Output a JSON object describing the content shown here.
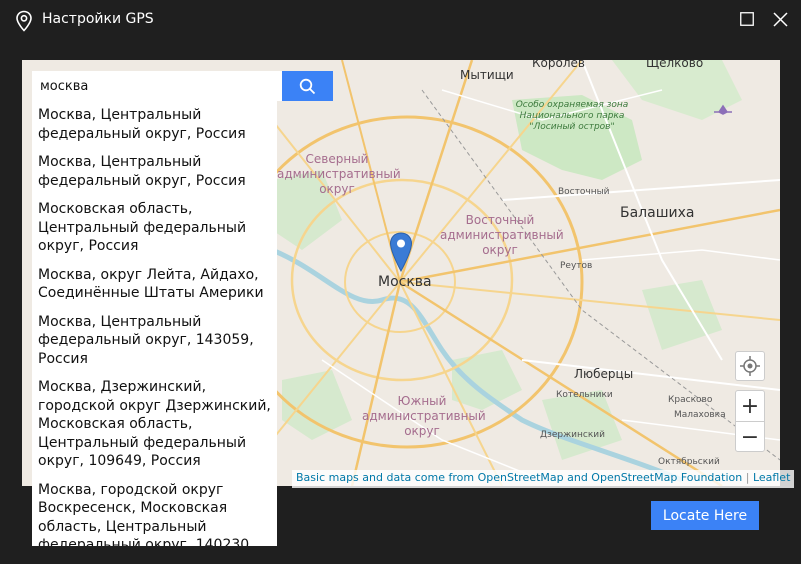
{
  "window": {
    "title": "Настройки GPS"
  },
  "search": {
    "value": "москва"
  },
  "results": [
    "Москва, Центральный федеральный округ, Россия",
    "Москва, Центральный федеральный округ, Россия",
    "Московская область, Центральный федеральный округ, Россия",
    "Москва, округ Лейта, Айдахо, Соединённые Штаты Америки",
    "Москва, Центральный федеральный округ, 143059, Россия",
    "Москва, Дзержинский, городской округ Дзержинский, Московская область, Центральный федеральный округ, 109649, Россия",
    "Москва, городской округ Воскресенск, Московская область, Центральный федеральный округ, 140230"
  ],
  "map": {
    "labels": {
      "mytishchi": "Мытищи",
      "korolev": "Королев",
      "shchelkovo": "Щелково",
      "park": "Особо охраняемая зона Национального парка \"Лосиный остров\"",
      "north": "Северный административный округ",
      "vostochny": "Восточный",
      "east": "Восточный административный округ",
      "balashikha": "Балашиха",
      "moscow": "Москва",
      "reutov": "Реутов",
      "lyubertsy": "Люберцы",
      "kotelniki": "Котельники",
      "krasnovo": "Красково",
      "malakhovka": "Малаховка",
      "south": "Южный административный округ",
      "dzerzhinsky": "Дзержинский",
      "oktyabrsky": "Октябрьский"
    },
    "zoom_in": "+",
    "zoom_out": "−",
    "attribution": "Basic maps and data come from OpenStreetMap and OpenStreetMap Foundation",
    "leaflet": "Leaflet"
  },
  "actions": {
    "locate_here": "Locate Here"
  },
  "colors": {
    "accent": "#3b82f6",
    "marker": "#3a7bd5",
    "titlebar": "#1f1f1f"
  }
}
